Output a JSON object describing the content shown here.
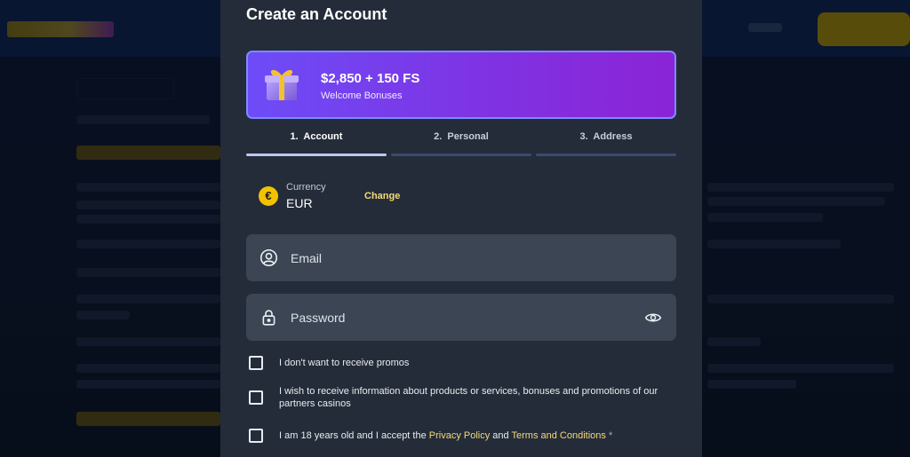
{
  "modal": {
    "title": "Create an Account",
    "bonus": {
      "amount": "$2,850 + 150 FS",
      "subtitle": "Welcome Bonuses",
      "icon": "gift-icon"
    },
    "steps": [
      {
        "label": "1.  Account",
        "active": true
      },
      {
        "label": "2.  Personal",
        "active": false
      },
      {
        "label": "3.  Address",
        "active": false
      }
    ],
    "currency": {
      "label": "Currency",
      "value": "EUR",
      "symbol": "€",
      "change_label": "Change"
    },
    "email": {
      "placeholder": "Email",
      "value": "",
      "icon": "user-circle-icon"
    },
    "password": {
      "placeholder": "Password",
      "value": "",
      "icon": "lock-icon",
      "toggle_icon": "eye-icon"
    },
    "checkboxes": {
      "promos": {
        "label": "I don't want to receive promos",
        "checked": false
      },
      "partners": {
        "label": "I wish to receive information about products or services, bonuses and promotions of our partners casinos",
        "checked": false
      },
      "age": {
        "prefix": "I am 18 years old and I accept the ",
        "privacy_link": "Privacy Policy",
        "and": " and ",
        "terms_link": "Terms and Conditions",
        "required_mark": " *",
        "checked": false
      }
    }
  },
  "colors": {
    "modal_bg": "#252c39",
    "field_bg": "#3b4554",
    "banner_start": "#6d4cf7",
    "banner_end": "#8b24d6",
    "accent_yellow": "#f3db77"
  }
}
